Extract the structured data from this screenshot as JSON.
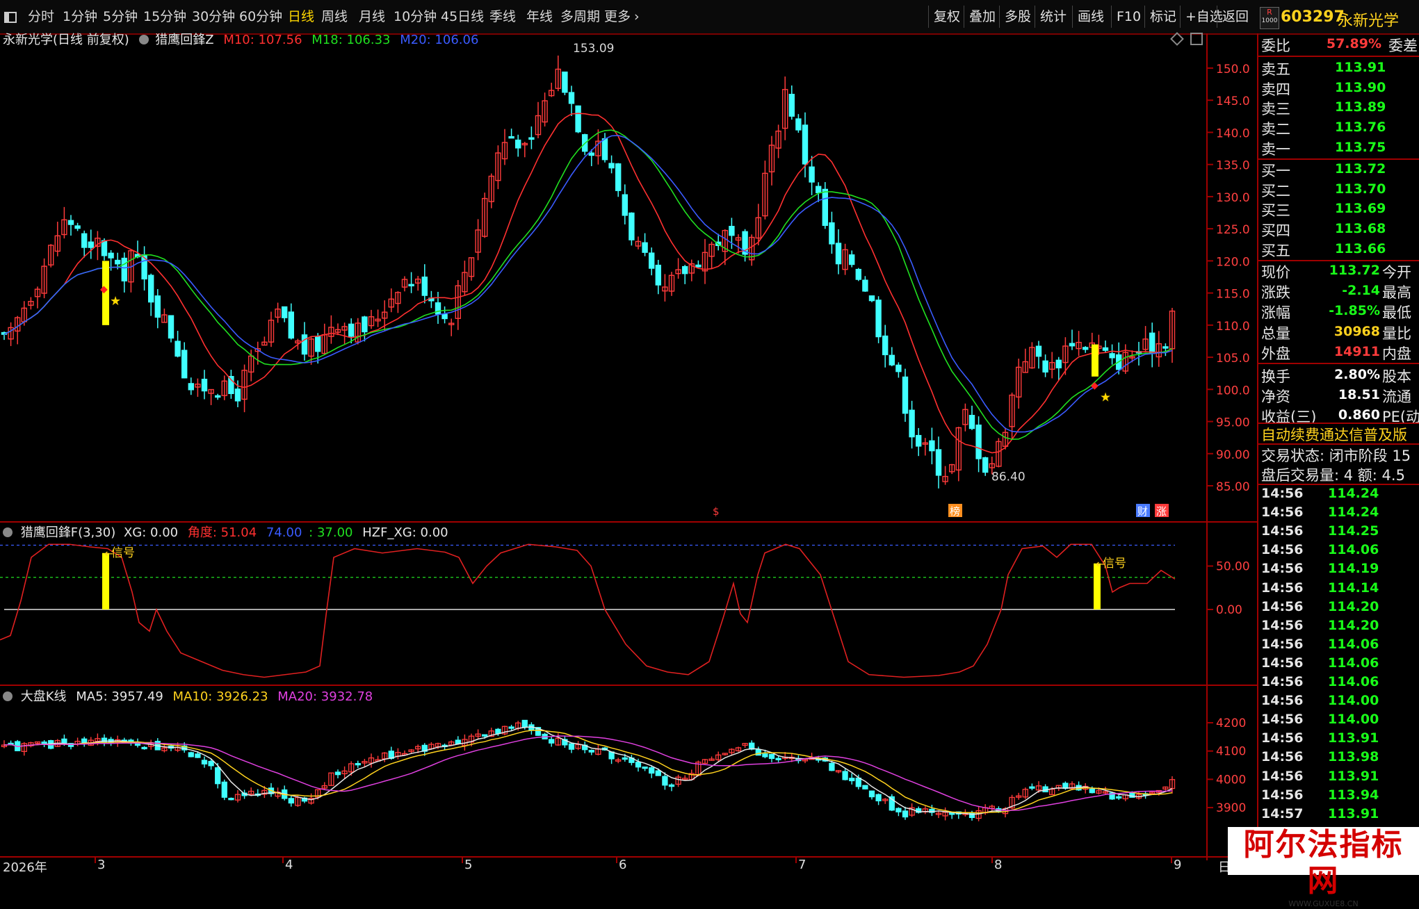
{
  "toolbar": {
    "left_icon": "window-icon",
    "periods": [
      "分时",
      "1分钟",
      "5分钟",
      "15分钟",
      "30分钟",
      "60分钟",
      "日线",
      "周线",
      "月线",
      "10分钟",
      "45日线",
      "季线",
      "年线",
      "多周期",
      "更多"
    ],
    "active_period": "日线",
    "more_arrow": "›",
    "tools": [
      "复权",
      "叠加",
      "多股",
      "统计",
      "画线",
      "F10",
      "标记",
      "+自选",
      "返回"
    ]
  },
  "quote_header": {
    "badge_top": "R",
    "badge_bottom": "1000",
    "code": "603297",
    "name": "永新光学"
  },
  "main_chart": {
    "title": "永新光学(日线 前复权)",
    "indicator": "猎鹰回鋒Z",
    "ma_labels": [
      {
        "text": "M10: 107.56",
        "color": "#ff3030"
      },
      {
        "text": "M18: 106.33",
        "color": "#20e020"
      },
      {
        "text": "M20: 106.06",
        "color": "#3a5bff"
      }
    ],
    "high_label": "153.09",
    "low_label": "86.40",
    "y_ticks": [
      "150.0",
      "145.0",
      "140.0",
      "135.0",
      "130.0",
      "125.0",
      "120.0",
      "115.0",
      "110.0",
      "105.0",
      "100.0",
      "95.00",
      "90.00",
      "85.00"
    ],
    "event_markers": [
      "$",
      "榜",
      "财",
      "涨"
    ]
  },
  "sub1": {
    "title": "猎鹰回鋒F(3,30)",
    "xg": "XG: 0.00",
    "angle": "角度: 51.04",
    "lvl1": "74.00",
    "lvl2": ": 37.00",
    "hzf": "HZF_XG: 0.00",
    "signal_label": "信号",
    "y_ticks": [
      "50.00",
      "0.00"
    ]
  },
  "sub2": {
    "title": "大盘K线",
    "ma5": "MA5: 3957.49",
    "ma10": "MA10: 3926.23",
    "ma20": "MA20: 3932.78",
    "y_ticks": [
      "4200",
      "4100",
      "4000",
      "3900"
    ]
  },
  "x_axis": {
    "labels": [
      "2026年",
      "3",
      "4",
      "5",
      "6",
      "7",
      "8",
      "9"
    ],
    "corner": "日"
  },
  "order_book": {
    "wei_bi_label": "委比",
    "wei_bi_value": "57.89%",
    "wei_cha_label": "委差",
    "sells": [
      {
        "label": "卖五",
        "price": "113.91"
      },
      {
        "label": "卖四",
        "price": "113.90"
      },
      {
        "label": "卖三",
        "price": "113.89"
      },
      {
        "label": "卖二",
        "price": "113.76"
      },
      {
        "label": "卖一",
        "price": "113.75"
      }
    ],
    "buys": [
      {
        "label": "买一",
        "price": "113.72"
      },
      {
        "label": "买二",
        "price": "113.70"
      },
      {
        "label": "买三",
        "price": "113.69"
      },
      {
        "label": "买四",
        "price": "113.68"
      },
      {
        "label": "买五",
        "price": "113.66"
      }
    ]
  },
  "stats": [
    {
      "label": "现价",
      "value": "113.72",
      "color": "green",
      "tail": "今开"
    },
    {
      "label": "涨跌",
      "value": "-2.14",
      "color": "green",
      "tail": "最高"
    },
    {
      "label": "涨幅",
      "value": "-1.85%",
      "color": "green",
      "tail": "最低"
    },
    {
      "label": "总量",
      "value": "30968",
      "color": "yellow",
      "tail": "量比"
    },
    {
      "label": "外盘",
      "value": "14911",
      "color": "red",
      "tail": "内盘"
    },
    {
      "label": "换手",
      "value": "2.80%",
      "color": "white",
      "tail": "股本"
    },
    {
      "label": "净资",
      "value": "18.51",
      "color": "white",
      "tail": "流通"
    },
    {
      "label": "收益(三)",
      "value": "0.860",
      "color": "white",
      "tail": "PE(动"
    }
  ],
  "notice": "自动续费通达信普及版",
  "trade_status": "交易状态: 闭市阶段 15",
  "after_hours": "盘后交易量: 4  额: 4.5",
  "ticks": [
    {
      "time": "14:56",
      "price": "114.24"
    },
    {
      "time": "14:56",
      "price": "114.24"
    },
    {
      "time": "14:56",
      "price": "114.25"
    },
    {
      "time": "14:56",
      "price": "114.06"
    },
    {
      "time": "14:56",
      "price": "114.19"
    },
    {
      "time": "14:56",
      "price": "114.14"
    },
    {
      "time": "14:56",
      "price": "114.20"
    },
    {
      "time": "14:56",
      "price": "114.20"
    },
    {
      "time": "14:56",
      "price": "114.06"
    },
    {
      "time": "14:56",
      "price": "114.06"
    },
    {
      "time": "14:56",
      "price": "114.06"
    },
    {
      "time": "14:56",
      "price": "114.00"
    },
    {
      "time": "14:56",
      "price": "114.00"
    },
    {
      "time": "14:56",
      "price": "113.91"
    },
    {
      "time": "14:56",
      "price": "113.98"
    },
    {
      "time": "14:56",
      "price": "113.91"
    },
    {
      "time": "14:56",
      "price": "113.94"
    },
    {
      "time": "14:57",
      "price": "113.91"
    }
  ],
  "watermark": {
    "text": "阿尔法指标网",
    "url": "WWW.GUXUE8.CN"
  },
  "colors": {
    "up": "#ff3b3b",
    "down": "#40ffff",
    "frame": "#a00000"
  }
}
